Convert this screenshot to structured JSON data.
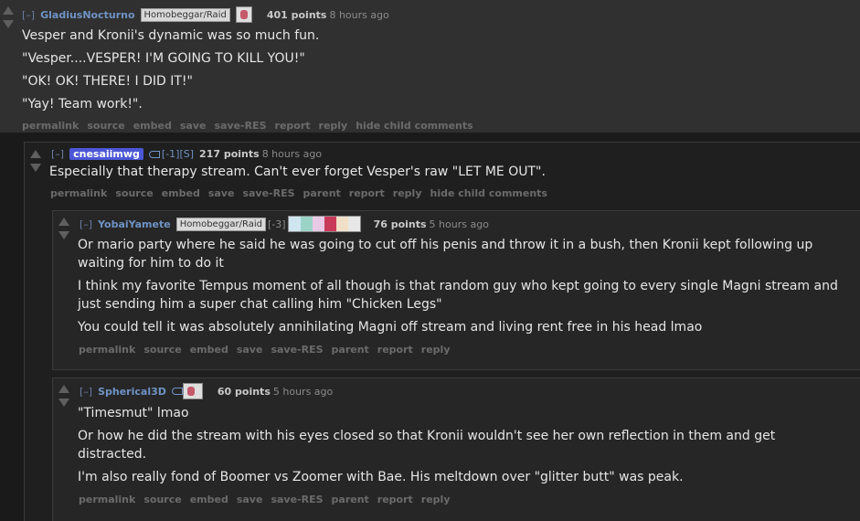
{
  "comments": [
    {
      "expand": "[–]",
      "author": "GladiusNocturno",
      "flair": "Homobeggar/Raid",
      "points": "401 points",
      "time": "8 hours ago",
      "paragraphs": [
        "Vesper and Kronii's dynamic was so much fun.",
        "\"Vesper....VESPER! I'M GOING TO KILL YOU!\"",
        "\"OK! OK! THERE! I DID IT!\"",
        "\"Yay! Team work!\"."
      ],
      "buttons": [
        "permalink",
        "source",
        "embed",
        "save",
        "save-RES",
        "report",
        "reply",
        "hide child comments"
      ]
    },
    {
      "expand": "[–]",
      "author": "cnesaiimwg",
      "extra": "[-1][S]",
      "points": "217 points",
      "time": "8 hours ago",
      "paragraphs": [
        "Especially that therapy stream. Can't ever forget Vesper's raw \"LET ME OUT\"."
      ],
      "buttons": [
        "permalink",
        "source",
        "embed",
        "save",
        "save-RES",
        "parent",
        "report",
        "reply",
        "hide child comments"
      ]
    },
    {
      "expand": "[–]",
      "author": "YobaiYamete",
      "flair": "Homobeggar/Raid",
      "extra": "[-3]",
      "points": "76 points",
      "time": "5 hours ago",
      "paragraphs": [
        "Or mario party where he said he was going to cut off his penis and throw it in a bush, then Kronii kept following up waiting for him to do it",
        "I think my favorite Tempus moment of all though is that random guy who kept going to every single Magni stream and just sending him a super chat calling him \"Chicken Legs\"",
        "You could tell it was absolutely annihilating Magni off stream and living rent free in his head lmao"
      ],
      "buttons": [
        "permalink",
        "source",
        "embed",
        "save",
        "save-RES",
        "parent",
        "report",
        "reply"
      ]
    },
    {
      "expand": "[–]",
      "author": "Spherical3D",
      "points": "60 points",
      "time": "5 hours ago",
      "paragraphs": [
        "\"Timesmut\" lmao",
        "Or how he did the stream with his eyes closed so that Kronii wouldn't see her own reflection in them and get distracted.",
        "I'm also really fond of Boomer vs Zoomer with Bae. His meltdown over \"glitter butt\" was peak."
      ],
      "buttons": [
        "permalink",
        "source",
        "embed",
        "save",
        "save-RES",
        "parent",
        "report",
        "reply"
      ]
    }
  ]
}
